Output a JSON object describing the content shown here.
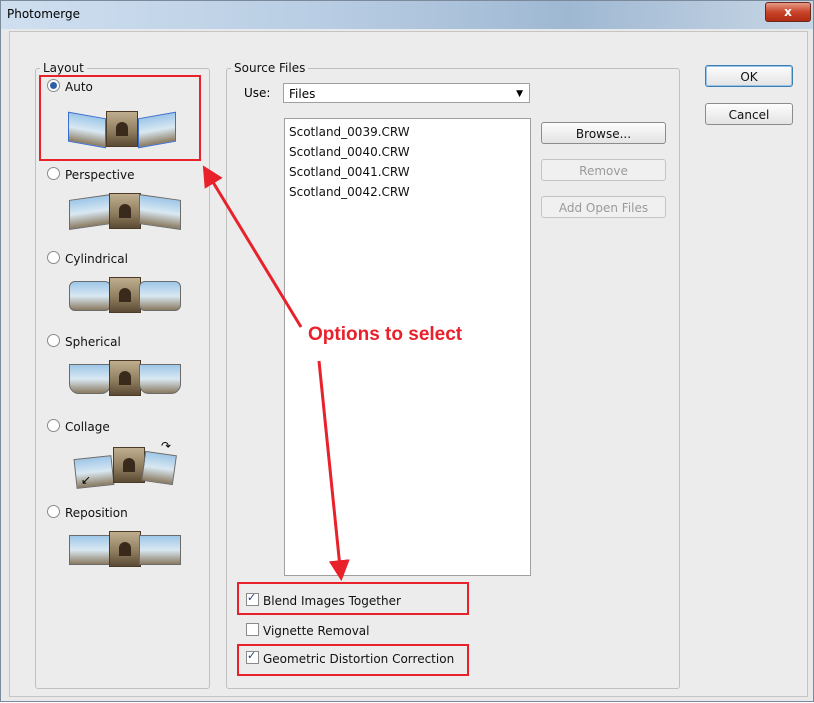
{
  "window": {
    "title": "Photomerge",
    "close_glyph": "x"
  },
  "layout_group": {
    "label": "Layout",
    "options": [
      {
        "label": "Auto",
        "selected": true,
        "icon": "auto-layout-thumbnail"
      },
      {
        "label": "Perspective",
        "selected": false,
        "icon": "perspective-thumbnail"
      },
      {
        "label": "Cylindrical",
        "selected": false,
        "icon": "cylindrical-thumbnail"
      },
      {
        "label": "Spherical",
        "selected": false,
        "icon": "spherical-thumbnail"
      },
      {
        "label": "Collage",
        "selected": false,
        "icon": "collage-thumbnail"
      },
      {
        "label": "Reposition",
        "selected": false,
        "icon": "reposition-thumbnail"
      }
    ]
  },
  "source_files": {
    "label": "Source Files",
    "use_label": "Use:",
    "use_value": "Files",
    "files": [
      "Scotland_0039.CRW",
      "Scotland_0040.CRW",
      "Scotland_0041.CRW",
      "Scotland_0042.CRW"
    ],
    "browse_label": "Browse...",
    "remove_label": "Remove",
    "add_open_label": "Add Open Files"
  },
  "options": {
    "blend": {
      "label": "Blend Images Together",
      "checked": true
    },
    "vignette": {
      "label": "Vignette Removal",
      "checked": false
    },
    "geometric": {
      "label": "Geometric Distortion Correction",
      "checked": true
    }
  },
  "buttons": {
    "ok_label": "OK",
    "cancel_label": "Cancel"
  },
  "annotation": {
    "text": "Options to select",
    "color": "#e8212b"
  }
}
